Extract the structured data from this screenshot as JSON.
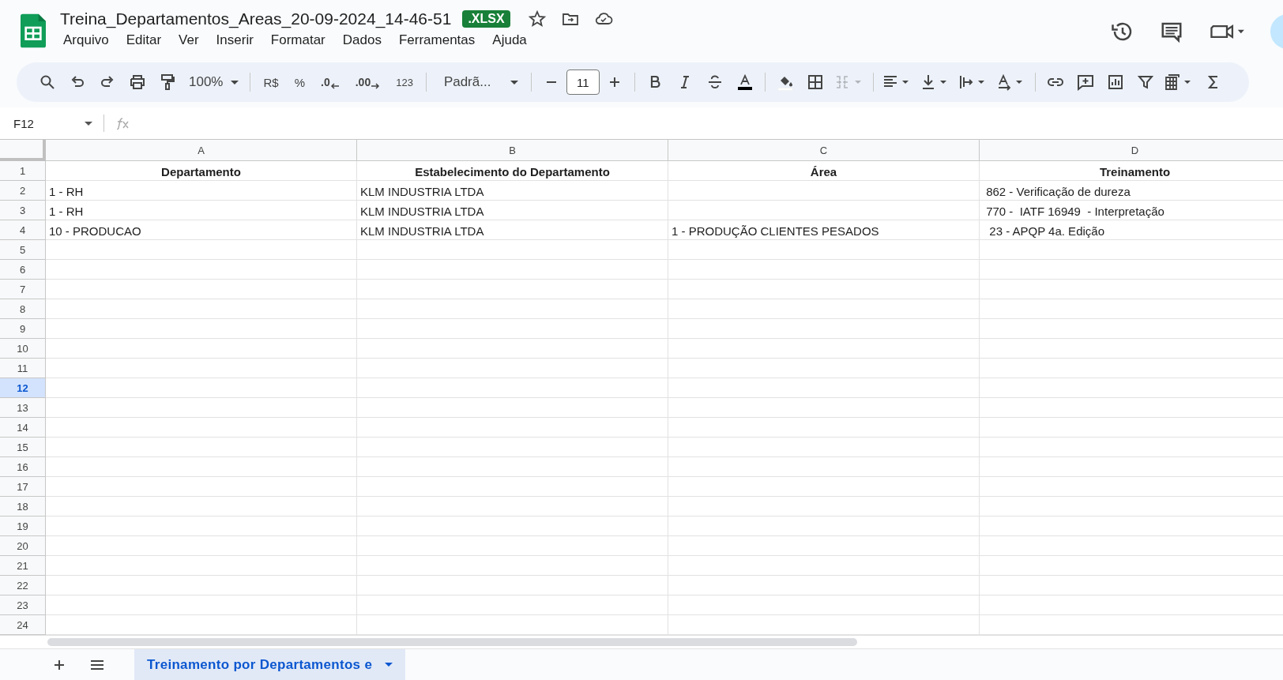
{
  "document": {
    "title": "Treina_Departamentos_Areas_20-09-2024_14-46-51",
    "badge": ".XLSX"
  },
  "menu": [
    "Arquivo",
    "Editar",
    "Ver",
    "Inserir",
    "Formatar",
    "Dados",
    "Ferramentas",
    "Ajuda"
  ],
  "toolbar": {
    "zoom": "100%",
    "currency": "R$",
    "percent": "%",
    "decrease_decimals": ".0",
    "increase_decimals": ".00",
    "number_format": "123",
    "font": "Padrã...",
    "font_size": "11",
    "merge_cells": {
      "disabled": true
    }
  },
  "formula_bar": {
    "name_box": "F12"
  },
  "columns": [
    {
      "letter": "A"
    },
    {
      "letter": "B"
    },
    {
      "letter": "C"
    },
    {
      "letter": "D"
    }
  ],
  "rows": [
    {
      "number": "1",
      "selected": false,
      "kind": "header",
      "cells": {
        "A": "Departamento",
        "B": "Estabelecimento do Departamento",
        "C": "Área",
        "D": "Treinamento"
      }
    },
    {
      "number": "2",
      "selected": false,
      "kind": "data",
      "cells": {
        "A": "1 - RH",
        "B": "KLM INDUSTRIA LTDA",
        "D": " 862 - Verificação de dureza"
      }
    },
    {
      "number": "3",
      "selected": false,
      "kind": "data",
      "cells": {
        "A": "1 - RH",
        "B": "KLM INDUSTRIA LTDA",
        "D": " 770 -  IATF 16949  - Interpretação"
      }
    },
    {
      "number": "4",
      "selected": false,
      "kind": "data",
      "cells": {
        "A": "10 - PRODUCAO",
        "B": "KLM INDUSTRIA LTDA",
        "C": "1 - PRODUÇÃO CLIENTES PESADOS",
        "D": "  23 - APQP 4a. Edição"
      }
    },
    {
      "number": "5",
      "selected": false
    },
    {
      "number": "6",
      "selected": false
    },
    {
      "number": "7",
      "selected": false
    },
    {
      "number": "8",
      "selected": false
    },
    {
      "number": "9",
      "selected": false
    },
    {
      "number": "10",
      "selected": false
    },
    {
      "number": "11",
      "selected": false
    },
    {
      "number": "12",
      "selected": true
    },
    {
      "number": "13",
      "selected": false
    },
    {
      "number": "14",
      "selected": false
    },
    {
      "number": "15",
      "selected": false
    },
    {
      "number": "16",
      "selected": false
    },
    {
      "number": "17",
      "selected": false
    },
    {
      "number": "18",
      "selected": false
    },
    {
      "number": "19",
      "selected": false
    },
    {
      "number": "20",
      "selected": false
    },
    {
      "number": "21",
      "selected": false
    },
    {
      "number": "22",
      "selected": false
    },
    {
      "number": "23",
      "selected": false
    },
    {
      "number": "24",
      "selected": false
    }
  ],
  "sheet_tabs": [
    {
      "label": "Treinamento por Departamentos e",
      "selected": true
    }
  ]
}
